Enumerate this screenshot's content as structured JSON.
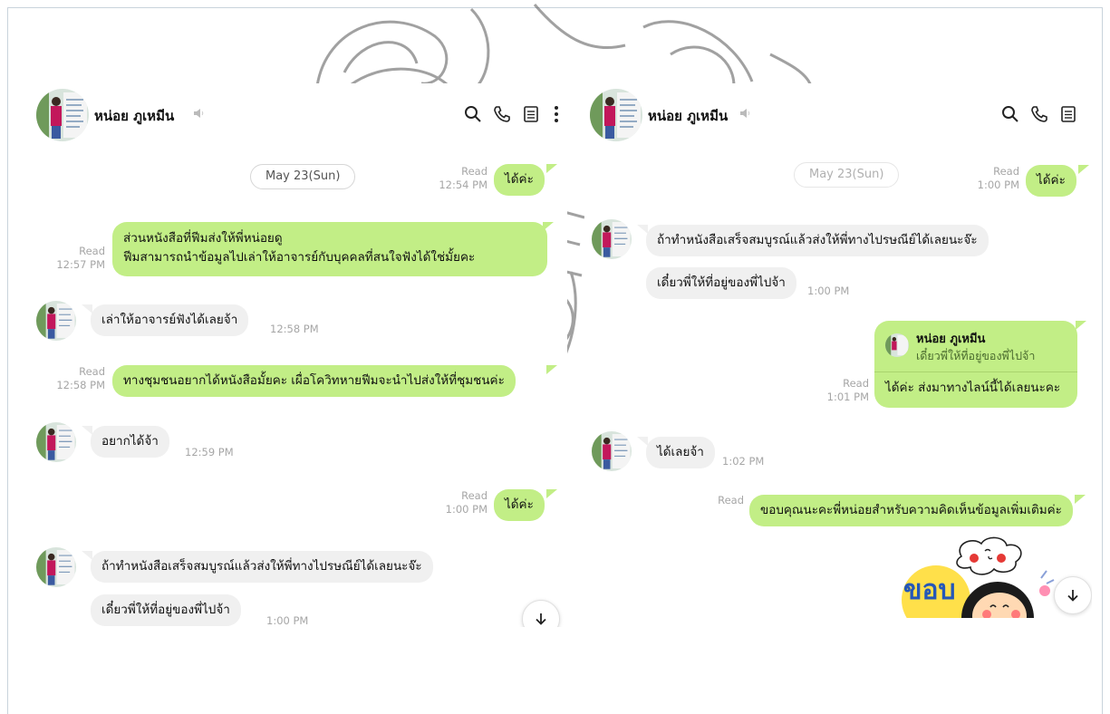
{
  "left_chat": {
    "contact_name": "หน่อย ภูเหมีน",
    "date_divider": "May 23(Sun)",
    "messages": [
      {
        "text": "ได้ค่ะ",
        "status": "Read",
        "time": "12:54 PM"
      },
      {
        "lines": [
          "ส่วนหนังสือที่ฟีมส่งให้พี่หน่อยดู",
          "ฟีมสามารถนำข้อมูลไปเล่าให้อาจารย์กับบุคคลที่สนใจฟังได้ใช่มั้ยคะ"
        ],
        "status": "Read",
        "time": "12:57 PM"
      },
      {
        "text": "เล่าให้อาจารย์ฟังได้เลยจ้า",
        "time": "12:58 PM"
      },
      {
        "text": "ทางชุมชนอยากได้หนังสือมั้ยคะ เผื่อโควิทหายฟีมจะนำไปส่งให้ที่ชุมชนค่ะ",
        "status": "Read",
        "time": "12:58 PM"
      },
      {
        "text": "อยากได้จ้า",
        "time": "12:59 PM"
      },
      {
        "text": "ได้ค่ะ",
        "status": "Read",
        "time": "1:00 PM"
      },
      {
        "text": "ถ้าทำหนังสือเสร็จสมบูรณ์แล้วส่งให้พี่ทางไปรษณีย์ได้เลยนะจ๊ะ"
      },
      {
        "text": "เดี๋ยวพี่ให้ที่อยู่ของพี่ไปจ้า",
        "time": "1:00 PM"
      }
    ]
  },
  "right_chat": {
    "contact_name": "หน่อย ภูเหมีน",
    "date_divider": "May 23(Sun)",
    "messages": [
      {
        "text": "ได้ค่ะ",
        "status": "Read",
        "time": "1:00 PM"
      },
      {
        "text": "ถ้าทำหนังสือเสร็จสมบูรณ์แล้วส่งให้พี่ทางไปรษณีย์ได้เลยนะจ๊ะ"
      },
      {
        "text": "เดี๋ยวพี่ให้ที่อยู่ของพี่ไปจ้า",
        "time": "1:00 PM"
      },
      {
        "reply_to_name": "หน่อย ภูเหมีน",
        "reply_to_text": "เดี๋ยวพี่ให้ที่อยู่ของพี่ไปจ้า",
        "text": "ได้ค่ะ ส่งมาทางไลน์นี้ได้เลยนะคะ",
        "status": "Read",
        "time": "1:01 PM"
      },
      {
        "text": "ได้เลยจ้า",
        "time": "1:02 PM"
      },
      {
        "text": "ขอบคุณนะคะพี่หน่อยสำหรับความคิดเห็นข้อมูลเพิ่มเติมค่ะ",
        "status": "Read"
      }
    ],
    "sticker_text": "ขอบ"
  },
  "icons": [
    "search-icon",
    "phone-icon",
    "notes-icon",
    "more-icon",
    "speaker-icon",
    "arrow-down-icon"
  ],
  "colors": {
    "outgoing_bubble": "#c2ee86",
    "incoming_bubble": "#f0f0f0",
    "meta_text": "#a6a6a6"
  }
}
